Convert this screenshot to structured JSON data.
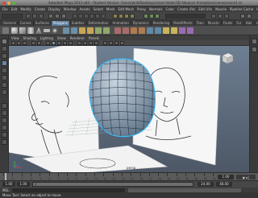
{
  "window": {
    "title": "Autodesk Maya 2013 x64 – Student Version: /Users/phili/Desktop/school folder/3D Advance Animation/scenes/scene1.mb"
  },
  "menubar": {
    "items": [
      "File",
      "Edit",
      "Modify",
      "Create",
      "Display",
      "Window",
      "Assets",
      "Select",
      "Mesh",
      "Edit Mesh",
      "Proxy",
      "Normals",
      "Color",
      "Create UVs",
      "Edit UVs",
      "Muscle",
      "Pipeline Cache",
      "Help"
    ]
  },
  "shelf_tabs": [
    {
      "label": "General",
      "active": false
    },
    {
      "label": "Curves",
      "active": false
    },
    {
      "label": "Surfaces",
      "active": false
    },
    {
      "label": "Polygons",
      "active": true
    },
    {
      "label": "Subdivs",
      "active": false
    },
    {
      "label": "Deformation",
      "active": false
    },
    {
      "label": "Animation",
      "active": false
    },
    {
      "label": "Dynamics",
      "active": false
    },
    {
      "label": "Rendering",
      "active": false
    },
    {
      "label": "PaintEffects",
      "active": false
    },
    {
      "label": "Toon",
      "active": false
    },
    {
      "label": "Muscle",
      "active": false
    },
    {
      "label": "Fluids",
      "active": false
    },
    {
      "label": "Fur",
      "active": false
    },
    {
      "label": "Hair",
      "active": false
    },
    {
      "label": "nCloth",
      "active": false
    },
    {
      "label": "Custom",
      "active": false
    }
  ],
  "panel_menu": {
    "items": [
      "View",
      "Shading",
      "Lighting",
      "Show",
      "Renderer",
      "Panels"
    ]
  },
  "viewport": {
    "front_label": "persp",
    "view_cube_label": "FRONT"
  },
  "time_slider": {
    "ticks": [
      "1",
      "2",
      "3",
      "4",
      "5",
      "6",
      "7",
      "8",
      "9",
      "10",
      "11",
      "12",
      "13",
      "14",
      "15",
      "16",
      "17",
      "18",
      "19",
      "20",
      "21",
      "22",
      "23",
      "24"
    ],
    "current_frame": "1.00"
  },
  "range_slider": {
    "start": "1.00",
    "inner_start": "1.00",
    "range_label": "1",
    "inner_end": "24.00",
    "end": "48.00"
  },
  "command_line": {
    "label": "MEL"
  },
  "help_line": {
    "text": "Move Tool: Select an object to move."
  },
  "colors": {
    "accent": "#5f7f9e",
    "wire": "#2aa8d8",
    "mesh": "#8aa0b6"
  },
  "icons": [
    "apple-icon",
    "gear-icon",
    "select-tool-icon",
    "lasso-icon",
    "move-tool-icon",
    "rotate-tool-icon",
    "scale-tool-icon",
    "sphere-icon",
    "cube-icon",
    "cylinder-icon",
    "cone-icon",
    "plane-icon",
    "view-cube-icon",
    "play-icon"
  ]
}
